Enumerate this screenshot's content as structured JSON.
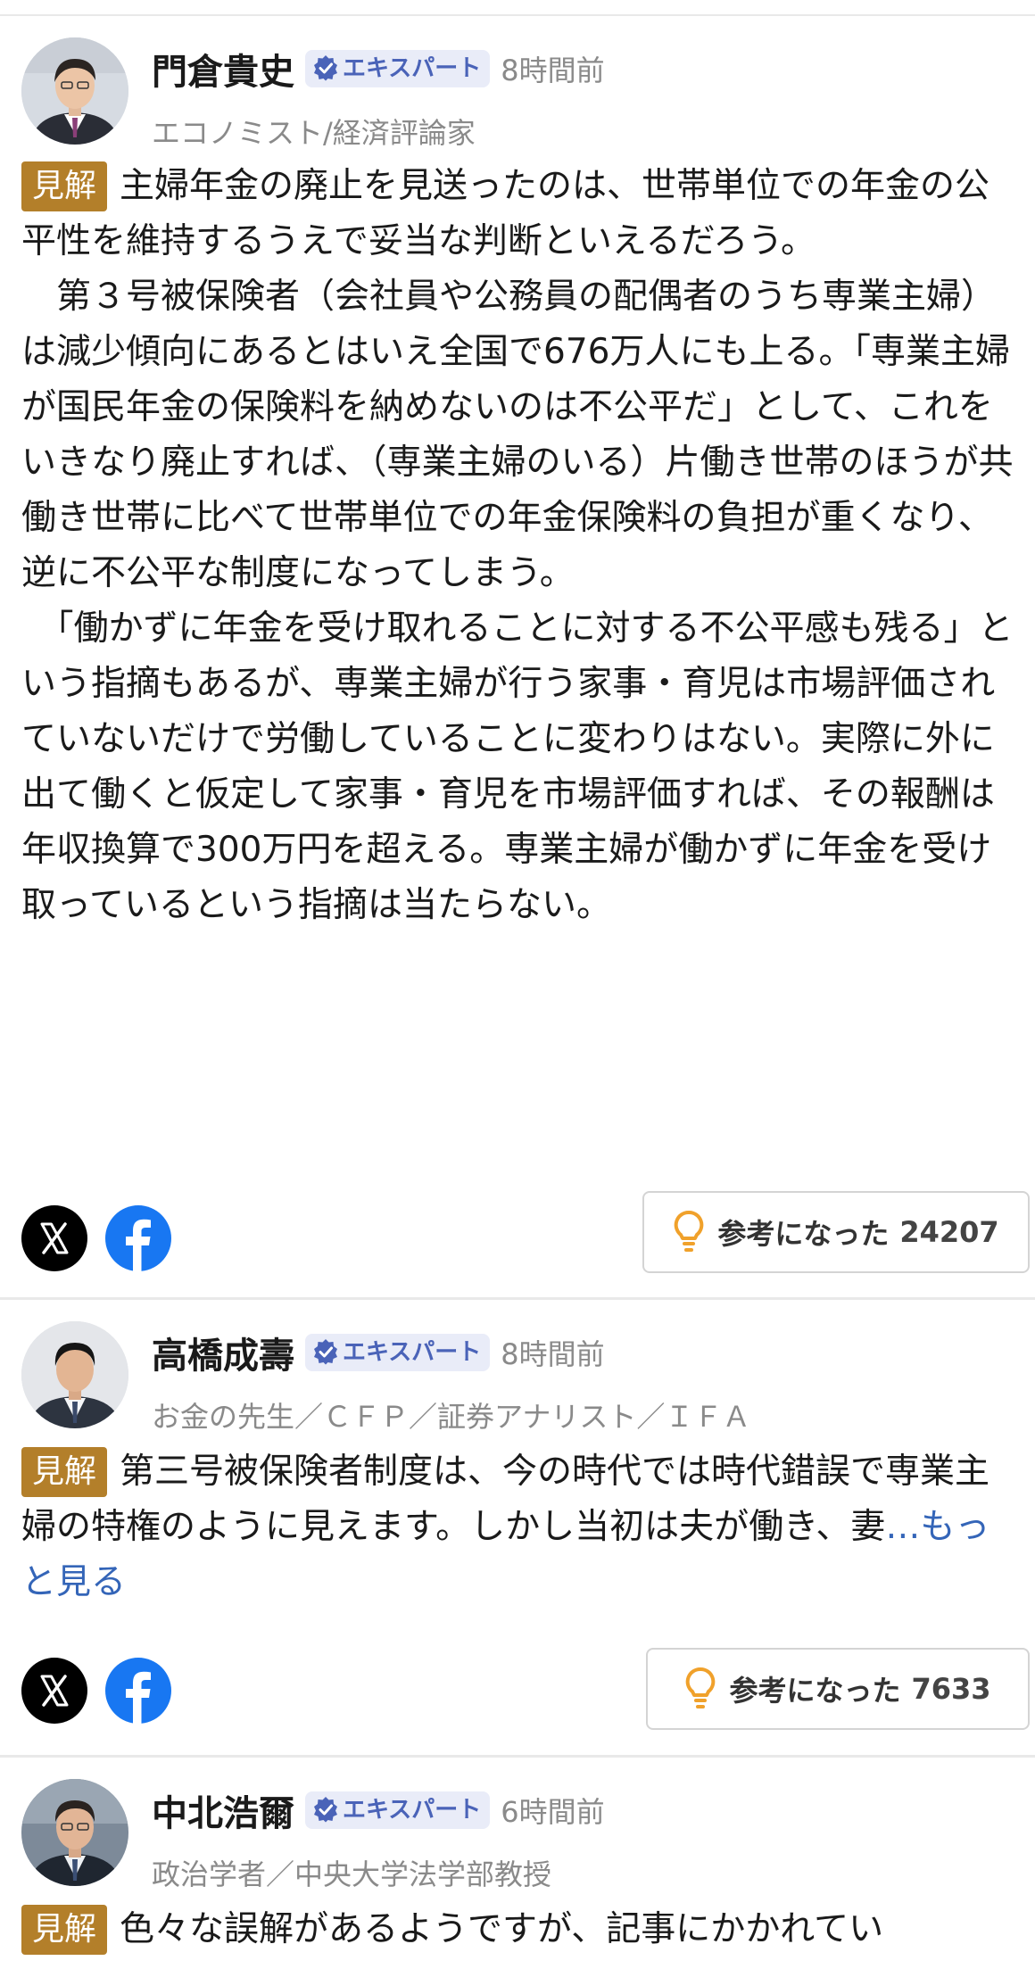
{
  "badge_label": "エキスパート",
  "tag_label": "見解",
  "helpful_label": "参考になった",
  "colors": {
    "tag": "#b37f2a",
    "badge_bg": "#e9ecf8",
    "badge_text": "#4a63b8",
    "link": "#3465b8",
    "bulb": "#f0a12b",
    "facebook": "#1877f2"
  },
  "comments": [
    {
      "name": "門倉貴史",
      "time": "8時間前",
      "role": "エコノミスト/経済評論家",
      "body": "主婦年金の廃止を見送ったのは、世帯単位での年金の公平性を維持するうえで妥当な判断といえるだろう。\n　第３号被保険者（会社員や公務員の配偶者のうち専業主婦）は減少傾向にあるとはいえ全国で676万人にも上る。「専業主婦が国民年金の保険料を納めないのは不公平だ」として、これをいきなり廃止すれば、（専業主婦のいる）片働き世帯のほうが共働き世帯に比べて世帯単位での年金保険料の負担が重くなり、逆に不公平な制度になってしまう。\n　「働かずに年金を受け取れることに対する不公平感も残る」という指摘もあるが、専業主婦が行う家事・育児は市場評価されていないだけで労働していることに変わりはない。実際に外に出て働くと仮定して家事・育児を市場評価すれば、その報酬は年収換算で300万円を超える。専業主婦が働かずに年金を受け取っているという指摘は当たらない。",
      "helpful_count": "24207",
      "icons": [
        "x-icon",
        "facebook-icon",
        "lightbulb-icon",
        "verified-icon"
      ]
    },
    {
      "name": "高橋成壽",
      "time": "8時間前",
      "role": "お金の先生／ＣＦＰ／証券アナリスト／ＩＦＡ",
      "body": "第三号被保険者制度は、今の時代では時代錯誤で専業主婦の特権のように見えます。しかし当初は夫が働き、妻",
      "more": "…もっと見る",
      "helpful_count": "7633"
    },
    {
      "name": "中北浩爾",
      "time": "6時間前",
      "role": "政治学者／中央大学法学部教授",
      "body": "色々な誤解があるようですが、記事にかかれてい"
    }
  ]
}
